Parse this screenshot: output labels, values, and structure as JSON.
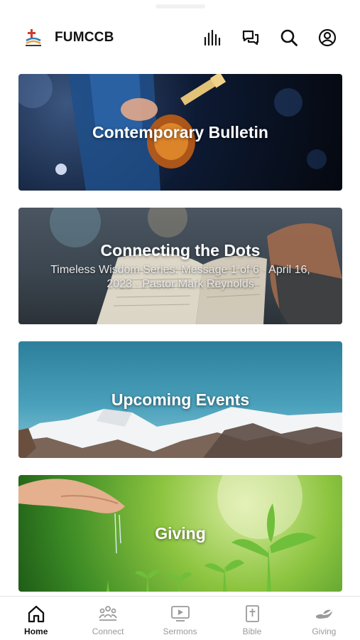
{
  "header": {
    "title": "FUMCCB",
    "logo_icon": "church-logo-icon",
    "icons": [
      "audio-bars-icon",
      "chat-bubbles-icon",
      "search-icon",
      "account-icon"
    ]
  },
  "cards": [
    {
      "title": "Contemporary Bulletin",
      "subtitle": "",
      "image": "guitar-player-photo"
    },
    {
      "title": "Connecting the Dots",
      "subtitle": "Timeless Wisdom Series: Message 1 of 6 · April 16, 2023 · Pastor Mark Reynolds",
      "image": "open-bible-photo"
    },
    {
      "title": "Upcoming Events",
      "subtitle": "",
      "image": "snowy-mountains-photo"
    },
    {
      "title": "Giving",
      "subtitle": "",
      "image": "hand-watering-sprouts-photo"
    }
  ],
  "tabs": [
    {
      "label": "Home",
      "icon": "home-icon",
      "active": true
    },
    {
      "label": "Connect",
      "icon": "people-group-icon",
      "active": false
    },
    {
      "label": "Sermons",
      "icon": "video-play-icon",
      "active": false
    },
    {
      "label": "Bible",
      "icon": "bible-cross-icon",
      "active": false
    },
    {
      "label": "Giving",
      "icon": "giving-hand-icon",
      "active": false
    }
  ],
  "colors": {
    "active_tab": "#111111",
    "inactive_tab": "#9a9a9a"
  }
}
